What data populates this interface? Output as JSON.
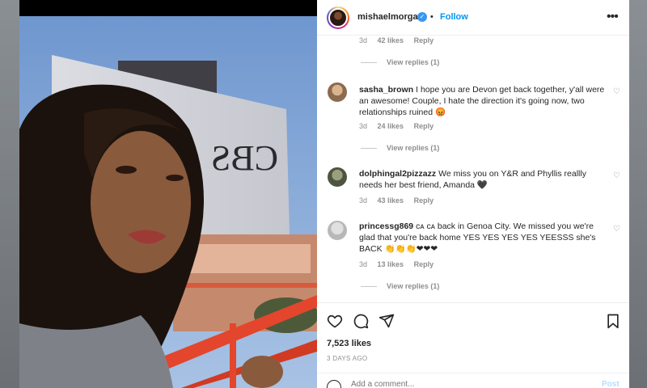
{
  "post": {
    "username": "mishaelmorgan",
    "verified_mark": "✓",
    "separator": "•",
    "follow_label": "Follow",
    "more_icon": "more-horizontal-icon",
    "sign_text": "CBS"
  },
  "first_meta": {
    "time": "3d",
    "likes": "42 likes",
    "reply": "Reply"
  },
  "comments": [
    {
      "user": "sasha_brown",
      "text": "I hope you are Devon get back together, y'all were an awesome! Couple, I hate the direction it's going now, two relationships ruined 😡",
      "time": "3d",
      "likes": "24 likes",
      "reply": "Reply"
    },
    {
      "user": "dolphingal2pizzazz",
      "text": "We miss you on Y&R and Phyllis reallly needs her best friend, Amanda 🖤",
      "time": "3d",
      "likes": "43 likes",
      "reply": "Reply"
    },
    {
      "user": "princessg869",
      "text": "ᴄᴀ ᴄᴀ back in Genoa City. We missed you we're glad that you're back home YES YES YES YES YEESSS she's BACK 👏👏👏❤❤❤",
      "time": "3d",
      "likes": "13 likes",
      "reply": "Reply"
    }
  ],
  "view_replies": [
    "View replies (1)",
    "View replies (1)",
    "View replies (1)"
  ],
  "likes_total": "7,523 likes",
  "date": "3 DAYS AGO",
  "add_comment": {
    "placeholder": "Add a comment...",
    "post_label": "Post"
  },
  "colors": {
    "accent": "#0095f6",
    "verified": "#3897f0",
    "muted": "#8e8e8e"
  },
  "icons": [
    "like-icon",
    "comment-icon",
    "share-icon",
    "save-icon",
    "emoji-icon"
  ]
}
